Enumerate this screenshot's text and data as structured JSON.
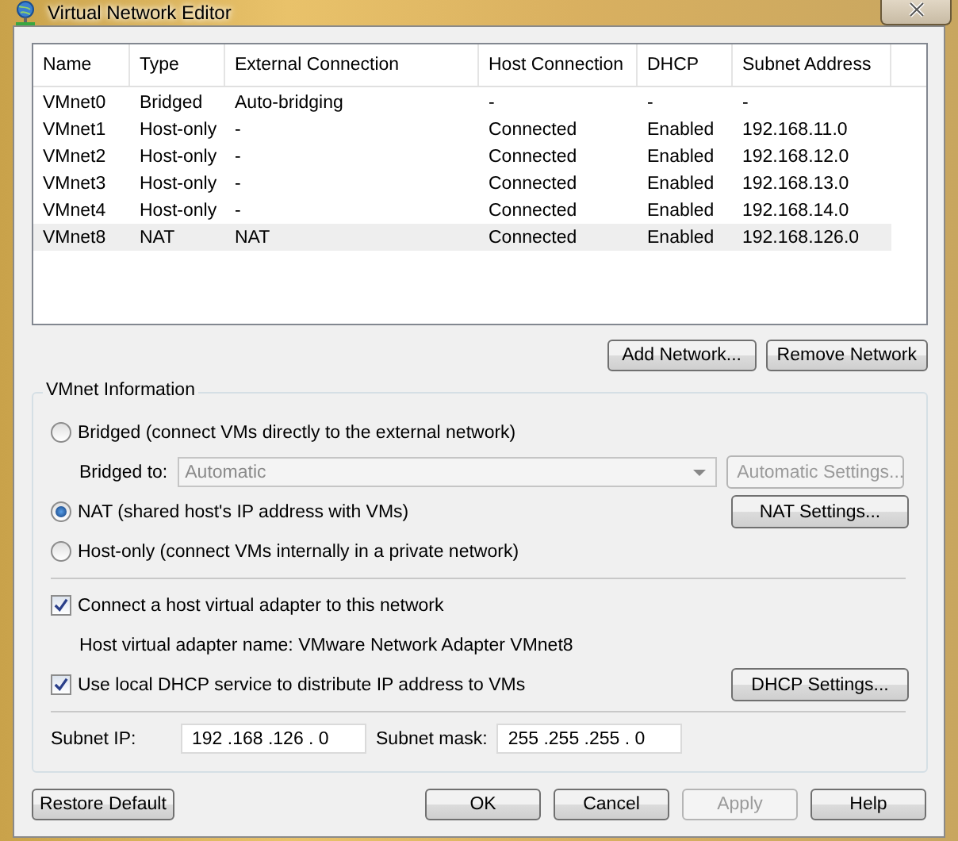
{
  "window": {
    "title": "Virtual Network Editor"
  },
  "table": {
    "columns": [
      "Name",
      "Type",
      "External Connection",
      "Host Connection",
      "DHCP",
      "Subnet Address"
    ],
    "rows": [
      {
        "cells": [
          "VMnet0",
          "Bridged",
          "Auto-bridging",
          "-",
          "-",
          "-"
        ],
        "selected": false
      },
      {
        "cells": [
          "VMnet1",
          "Host-only",
          "-",
          "Connected",
          "Enabled",
          "192.168.11.0"
        ],
        "selected": false
      },
      {
        "cells": [
          "VMnet2",
          "Host-only",
          "-",
          "Connected",
          "Enabled",
          "192.168.12.0"
        ],
        "selected": false
      },
      {
        "cells": [
          "VMnet3",
          "Host-only",
          "-",
          "Connected",
          "Enabled",
          "192.168.13.0"
        ],
        "selected": false
      },
      {
        "cells": [
          "VMnet4",
          "Host-only",
          "-",
          "Connected",
          "Enabled",
          "192.168.14.0"
        ],
        "selected": false
      },
      {
        "cells": [
          "VMnet8",
          "NAT",
          "NAT",
          "Connected",
          "Enabled",
          "192.168.126.0"
        ],
        "selected": true
      }
    ]
  },
  "list_buttons": [
    {
      "label": "Add Network...",
      "disabled": false
    },
    {
      "label": "Remove Network",
      "disabled": false
    }
  ],
  "vmnet_info": {
    "title": "VMnet Information",
    "modes": [
      {
        "label": "Bridged (connect VMs directly to the external network)",
        "selected": false,
        "kind": "bridged"
      },
      {
        "label": "NAT (shared host's IP address with VMs)",
        "selected": true,
        "kind": "nat"
      },
      {
        "label": "Host-only (connect VMs internally in a private network)",
        "selected": false,
        "kind": "plain"
      }
    ],
    "bridged_to": {
      "label": "Bridged to:",
      "value": "Automatic",
      "disabled": true
    },
    "automatic_settings": {
      "label": "Automatic Settings...",
      "disabled": true
    },
    "nat_settings": {
      "label": "NAT Settings...",
      "disabled": false
    },
    "host_adapter": {
      "label": "Connect a host virtual adapter to this network",
      "checked": true
    },
    "adapter_name": "Host virtual adapter name: VMware Network Adapter VMnet8",
    "dhcp": {
      "label": "Use local DHCP service to distribute IP address to VMs",
      "checked": true
    },
    "dhcp_settings": {
      "label": "DHCP Settings...",
      "disabled": false
    },
    "subnet_ip": {
      "label": "Subnet IP:",
      "value": "192 .168 .126 . 0"
    },
    "subnet_mask": {
      "label": "Subnet mask:",
      "value": "255 .255 .255 . 0"
    }
  },
  "restore_button": {
    "label": "Restore Default",
    "disabled": false
  },
  "dialog_buttons": [
    {
      "label": "OK",
      "disabled": false
    },
    {
      "label": "Cancel",
      "disabled": false
    },
    {
      "label": "Apply",
      "disabled": true
    },
    {
      "label": "Help",
      "disabled": false
    }
  ]
}
